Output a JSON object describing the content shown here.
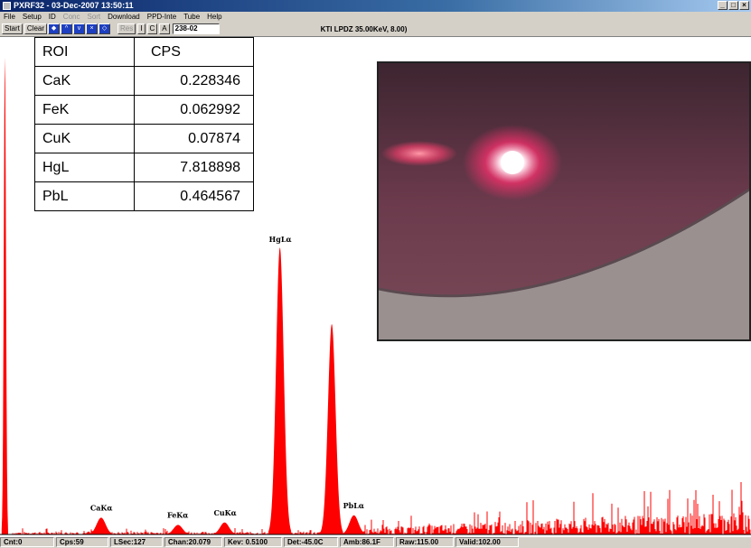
{
  "window": {
    "title": "PXRF32 - 03-Dec-2007 13:50:11",
    "icon": "app-icon",
    "controls": [
      "_",
      "□",
      "×"
    ]
  },
  "menu": [
    {
      "label": "File",
      "enabled": true
    },
    {
      "label": "Setup",
      "enabled": true
    },
    {
      "label": "ID",
      "enabled": true
    },
    {
      "label": "Conc",
      "enabled": false
    },
    {
      "label": "Sort",
      "enabled": false
    },
    {
      "label": "Download",
      "enabled": true
    },
    {
      "label": "PPD-Inte",
      "enabled": true
    },
    {
      "label": "Tube",
      "enabled": true
    },
    {
      "label": "Help",
      "enabled": true
    }
  ],
  "toolbar": {
    "start_label": "Start",
    "clear_label": "Clear",
    "nav_icons": [
      "◆",
      "^",
      "v",
      "×",
      "◇"
    ],
    "res_label": "Res",
    "i_label": "I",
    "c_label": "C",
    "a_label": "A",
    "sample_field": "238-02",
    "kti_label": "KTI  LPDZ 35.00KeV, 8.00)"
  },
  "roi_table": {
    "headers": [
      "ROI",
      "CPS"
    ],
    "rows": [
      {
        "roi": "CaK",
        "cps": "0.228346"
      },
      {
        "roi": "FeK",
        "cps": "0.062992"
      },
      {
        "roi": "CuK",
        "cps": "0.07874"
      },
      {
        "roi": "HgL",
        "cps": "7.818898"
      },
      {
        "roi": "PbL",
        "cps": "0.464567"
      }
    ]
  },
  "chart_data": {
    "type": "area",
    "xlabel": "",
    "ylabel": "",
    "xlim": [
      0,
      26.2
    ],
    "x_ticks": [
      "2.00",
      "4.00",
      "6.00",
      "8.00",
      "10.00",
      "12.00",
      "14.00",
      "16.00",
      "18.00",
      "20.00",
      "22.00",
      "24.00"
    ],
    "peaks": [
      {
        "label": "CaKα",
        "kev": 3.69,
        "height": 0.035
      },
      {
        "label": "FeKα",
        "kev": 6.4,
        "height": 0.02
      },
      {
        "label": "CuKα",
        "kev": 8.04,
        "height": 0.025
      },
      {
        "label": "HgLα",
        "kev": 9.99,
        "height": 0.6
      },
      {
        "label": "",
        "kev": 11.82,
        "height": 0.44
      },
      {
        "label": "PbLα",
        "kev": 12.6,
        "height": 0.04
      }
    ],
    "low_energy_peak": {
      "kev": 0.3,
      "height": 1.0
    },
    "color": "#ff0000",
    "grid": false
  },
  "status_bar": [
    "Cnt:0",
    "Cps:59",
    "LSec:127",
    "Chan:20.079",
    "Kev: 0.5100",
    "Det:-45.0C",
    "Amb:86.1F",
    "Raw:115.00",
    "Valid:102.00"
  ]
}
